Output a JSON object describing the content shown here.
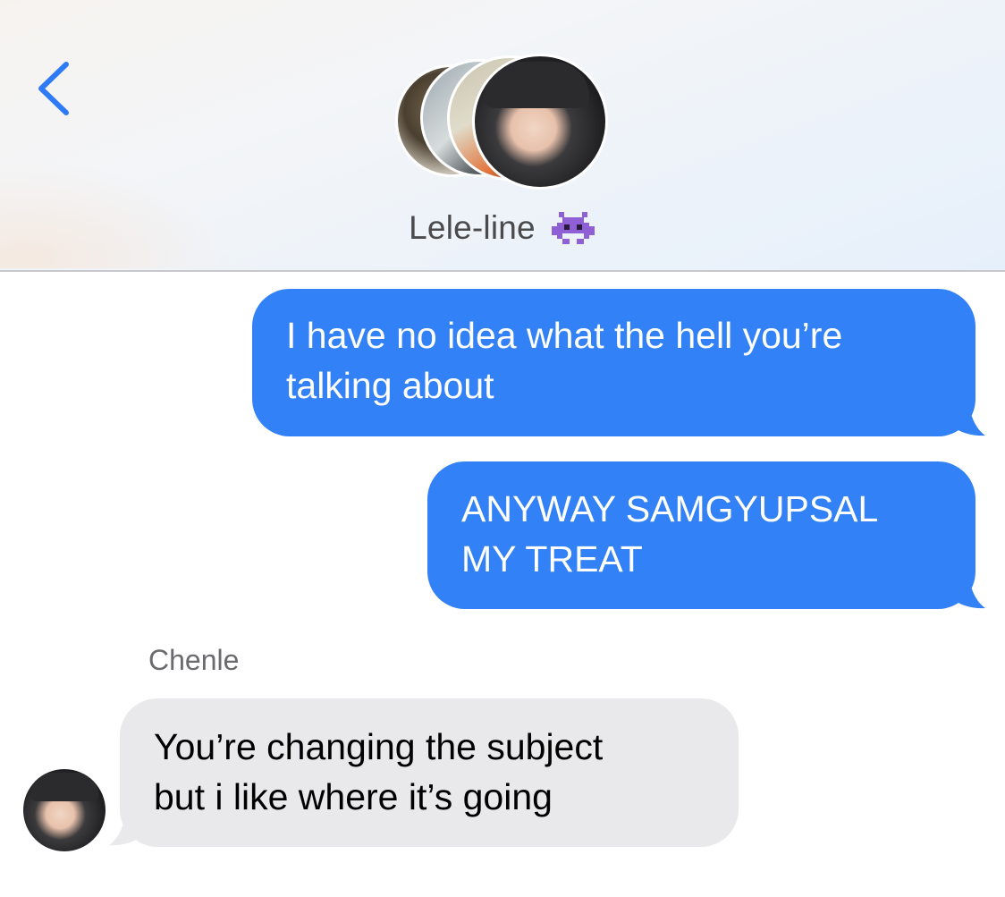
{
  "header": {
    "title": "Lele-line",
    "title_emoji": "alien-monster-icon"
  },
  "messages": [
    {
      "direction": "outgoing",
      "lines": [
        "I have no idea what the hell you’re",
        "talking about"
      ]
    },
    {
      "direction": "outgoing",
      "lines": [
        "ANYWAY SAMGYUPSAL",
        "MY TREAT"
      ]
    },
    {
      "direction": "incoming",
      "sender": "Chenle",
      "lines": [
        "You’re changing the subject",
        "but i like where it’s going"
      ]
    }
  ],
  "colors": {
    "outgoing_bubble": "#3381f6",
    "incoming_bubble": "#e9e9eb",
    "accent": "#2f7bf5"
  }
}
